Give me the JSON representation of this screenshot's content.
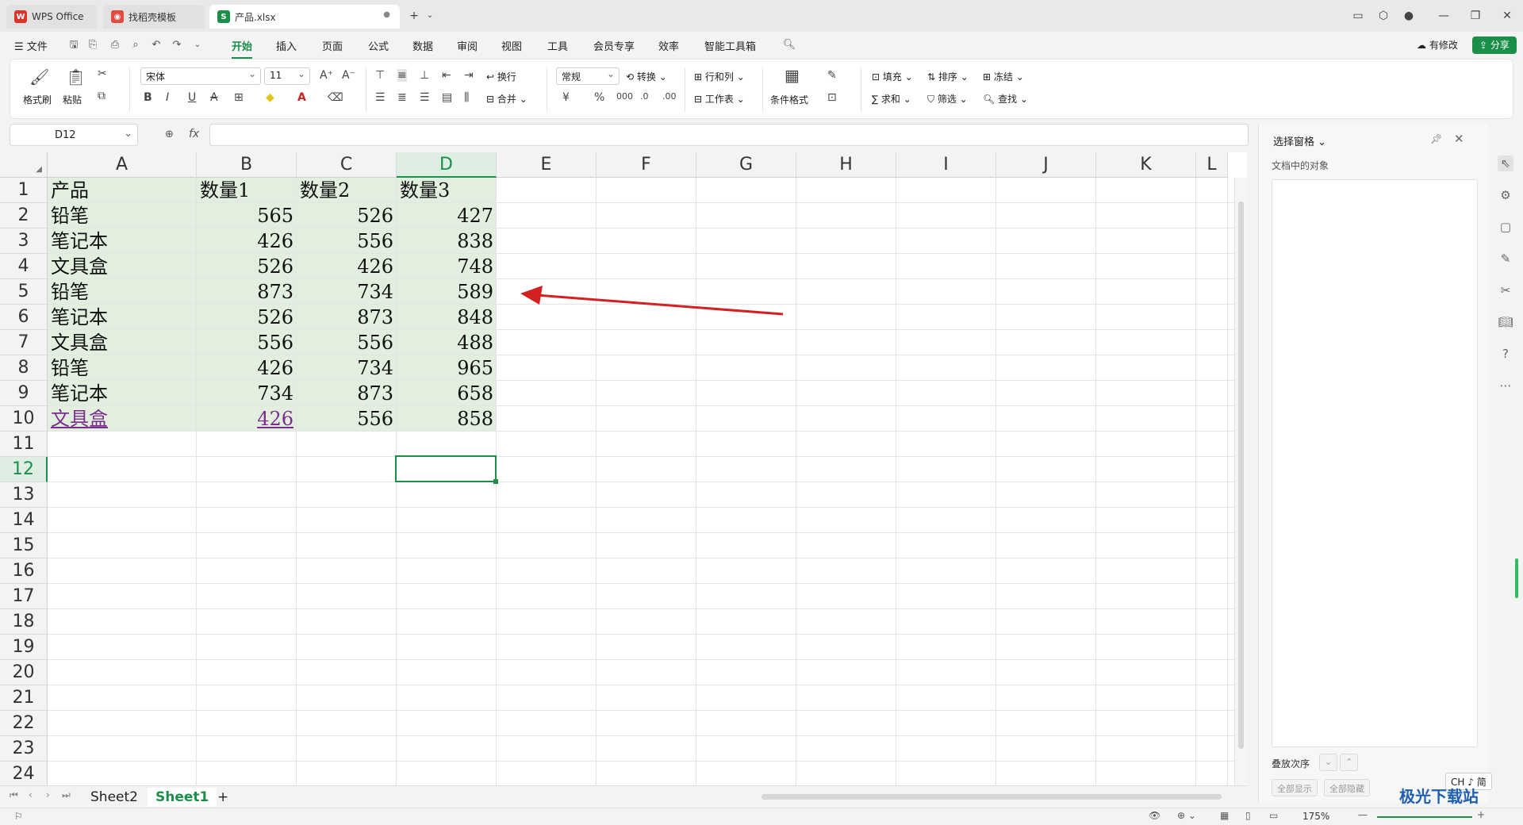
{
  "tabs": [
    {
      "label": "WPS Office",
      "icon": "wps-logo-icon",
      "active": false
    },
    {
      "label": "找稻壳模板",
      "icon": "docer-icon",
      "active": false
    },
    {
      "label": "产品.xlsx",
      "icon": "spreadsheet-icon",
      "active": true
    }
  ],
  "menu": {
    "file": "文件",
    "items": [
      "开始",
      "插入",
      "页面",
      "公式",
      "数据",
      "审阅",
      "视图",
      "工具",
      "会员专享",
      "效率",
      "智能工具箱"
    ],
    "active": "开始",
    "modified": "有修改",
    "share": "分享"
  },
  "ribbon": {
    "format_painter": "格式刷",
    "paste": "粘贴",
    "font_name": "宋体",
    "font_size": "11",
    "wrap": "换行",
    "merge": "合并",
    "number_format": "常规",
    "convert": "转换",
    "rows_cols": "行和列",
    "worksheet": "工作表",
    "conditional_format": "条件格式",
    "fill": "填充",
    "sort": "排序",
    "freeze": "冻结",
    "sum": "求和",
    "filter": "筛选",
    "find": "查找",
    "currency": "¥",
    "percent": "%"
  },
  "formula_bar": {
    "name_box": "D12",
    "fx": "fx",
    "content": ""
  },
  "columns": [
    "A",
    "B",
    "C",
    "D",
    "E",
    "F",
    "G",
    "H",
    "I",
    "J",
    "K",
    "L"
  ],
  "rows": [
    "1",
    "2",
    "3",
    "4",
    "5",
    "6",
    "7",
    "8",
    "9",
    "10",
    "11",
    "12",
    "13",
    "14",
    "15",
    "16",
    "17",
    "18",
    "19",
    "20",
    "21",
    "22",
    "23",
    "24"
  ],
  "table": {
    "headers": [
      "产品",
      "数量1",
      "数量2",
      "数量3"
    ],
    "rows": [
      [
        "铅笔",
        "565",
        "526",
        "427"
      ],
      [
        "笔记本",
        "426",
        "556",
        "838"
      ],
      [
        "文具盒",
        "526",
        "426",
        "748"
      ],
      [
        "铅笔",
        "873",
        "734",
        "589"
      ],
      [
        "笔记本",
        "526",
        "873",
        "848"
      ],
      [
        "文具盒",
        "556",
        "556",
        "488"
      ],
      [
        "铅笔",
        "426",
        "734",
        "965"
      ],
      [
        "笔记本",
        "734",
        "873",
        "658"
      ],
      [
        "文具盒",
        "426",
        "556",
        "858"
      ]
    ]
  },
  "sheets": [
    {
      "label": "Sheet2",
      "active": false
    },
    {
      "label": "Sheet1",
      "active": true
    }
  ],
  "add_sheet": "+",
  "status": {
    "zoom": "175%"
  },
  "panel": {
    "title": "选择窗格",
    "subtitle": "文档中的对象",
    "order_label": "叠放次序",
    "show_all": "全部显示",
    "hide_all": "全部隐藏"
  },
  "ime": "CH ♪ 简",
  "watermark": "极光下载站",
  "colors": {
    "accent": "#1a8f4a",
    "fill": "#e2efdf",
    "arrow": "#d42020",
    "link": "#7b2c8e"
  }
}
